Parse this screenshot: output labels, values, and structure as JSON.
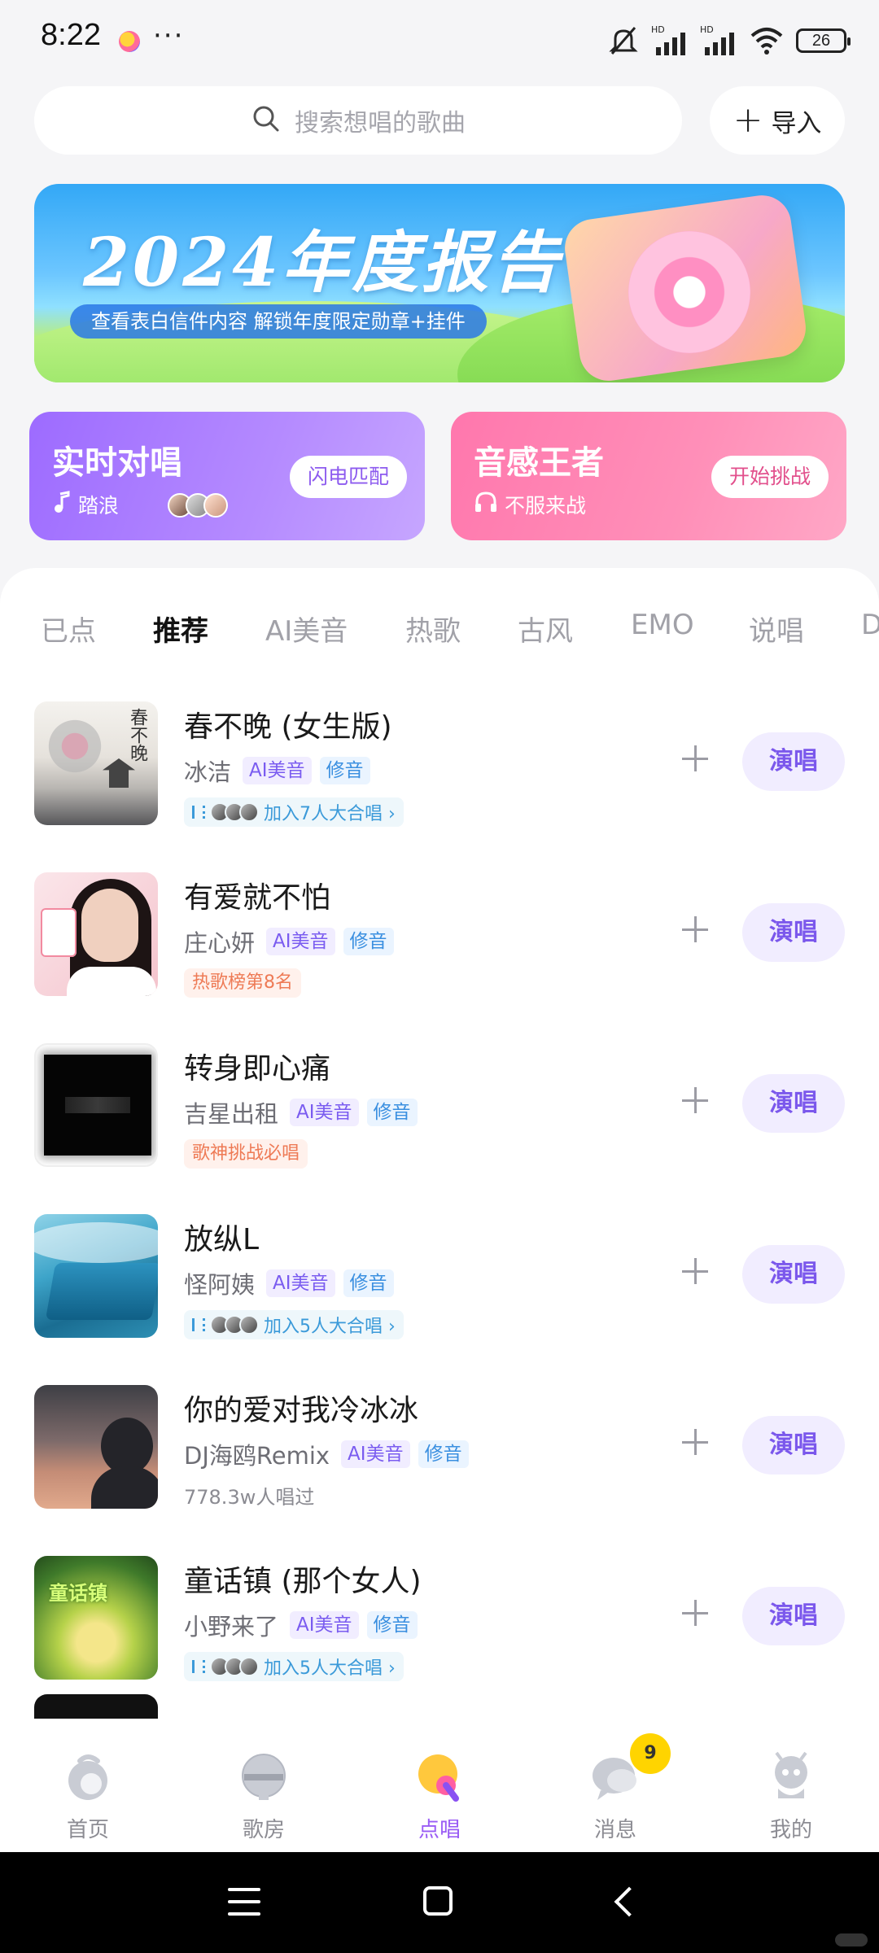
{
  "status_bar": {
    "time": "8:22",
    "more": "···",
    "battery": "26",
    "network_labels": [
      "HD",
      "HD"
    ]
  },
  "search": {
    "placeholder": "搜索想唱的歌曲",
    "import_label": "导入"
  },
  "banner": {
    "title": "2024年度报告",
    "subtitle": "查看表白信件内容  解锁年度限定勋章+挂件"
  },
  "cards": {
    "duet": {
      "title": "实时对唱",
      "sub": "踏浪",
      "button": "闪电匹配"
    },
    "king": {
      "title": "音感王者",
      "sub": "不服来战",
      "button": "开始挑战"
    }
  },
  "tabs": [
    "已点",
    "推荐",
    "AI美音",
    "热歌",
    "古风",
    "EMO",
    "说唱",
    "D"
  ],
  "active_tab": "推荐",
  "songs": [
    {
      "title": "春不晚 (女生版)",
      "singer": "冰洁",
      "tags": [
        "AI美音",
        "修音"
      ],
      "extra_type": "join",
      "extra": "加入7人大合唱 ›",
      "cover_text": "春不晚"
    },
    {
      "title": "有爱就不怕",
      "singer": "庄心妍",
      "tags": [
        "AI美音",
        "修音"
      ],
      "extra_type": "rank",
      "extra": "热歌榜第8名"
    },
    {
      "title": "转身即心痛",
      "singer": "吉星出租",
      "tags": [
        "AI美音",
        "修音"
      ],
      "extra_type": "rank",
      "extra": "歌神挑战必唱"
    },
    {
      "title": "放纵L",
      "singer": "怪阿姨",
      "tags": [
        "AI美音",
        "修音"
      ],
      "extra_type": "join",
      "extra": "加入5人大合唱 ›"
    },
    {
      "title": "你的爱对我冷冰冰",
      "singer": "DJ海鸥Remix",
      "tags": [
        "AI美音",
        "修音"
      ],
      "extra_type": "plain",
      "extra": "778.3w人唱过"
    },
    {
      "title": "童话镇 (那个女人)",
      "singer": "小野来了",
      "tags": [
        "AI美音",
        "修音"
      ],
      "extra_type": "join",
      "extra": "加入5人大合唱 ›",
      "cover_text": "童话镇"
    }
  ],
  "sing_label": "演唱",
  "bottom_nav": [
    {
      "label": "首页",
      "icon": "home-icon"
    },
    {
      "label": "歌房",
      "icon": "room-icon"
    },
    {
      "label": "点唱",
      "icon": "sing-icon",
      "active": true
    },
    {
      "label": "消息",
      "icon": "message-icon",
      "badge": "9"
    },
    {
      "label": "我的",
      "icon": "profile-icon"
    }
  ],
  "colors": {
    "accent": "#9a5cf5",
    "duet_card": "#a877ff",
    "king_card": "#ff82b2",
    "tab_highlight": "#ffd93d"
  }
}
